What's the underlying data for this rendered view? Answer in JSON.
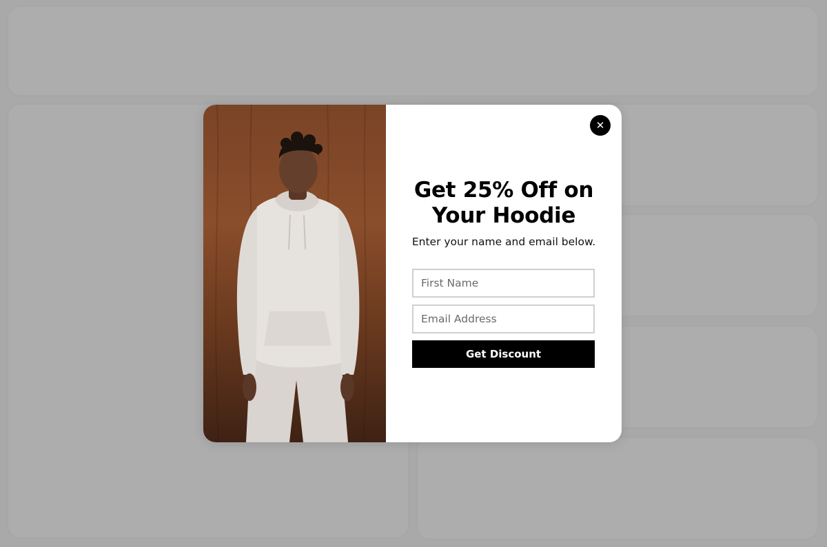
{
  "popup": {
    "headline": "Get 25% Off on Your Hoodie",
    "subtext": "Enter your name and email below.",
    "first_name_placeholder": "First Name",
    "email_placeholder": "Email Address",
    "submit_label": "Get Discount",
    "close_glyph": "✕",
    "close_icon": "close-icon",
    "accent_color": "#000000",
    "image": "model wearing white hoodie and sweatpants against wooden wall"
  }
}
